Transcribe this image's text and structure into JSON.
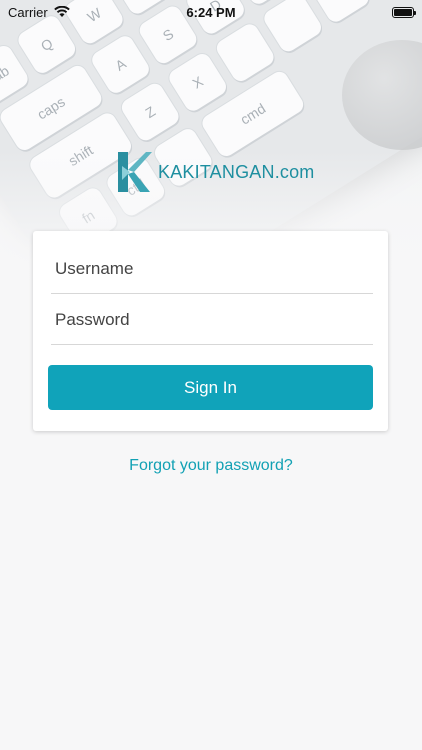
{
  "status_bar": {
    "carrier": "Carrier",
    "time": "6:24 PM"
  },
  "logo": {
    "text": "KAKITANGAN.com",
    "color": "#1e8fa0"
  },
  "login_form": {
    "username_placeholder": "Username",
    "password_placeholder": "Password",
    "username_value": "",
    "password_value": "",
    "sign_in_label": "Sign In",
    "button_color": "#10a3ba"
  },
  "forgot_link": "Forgot your password?"
}
